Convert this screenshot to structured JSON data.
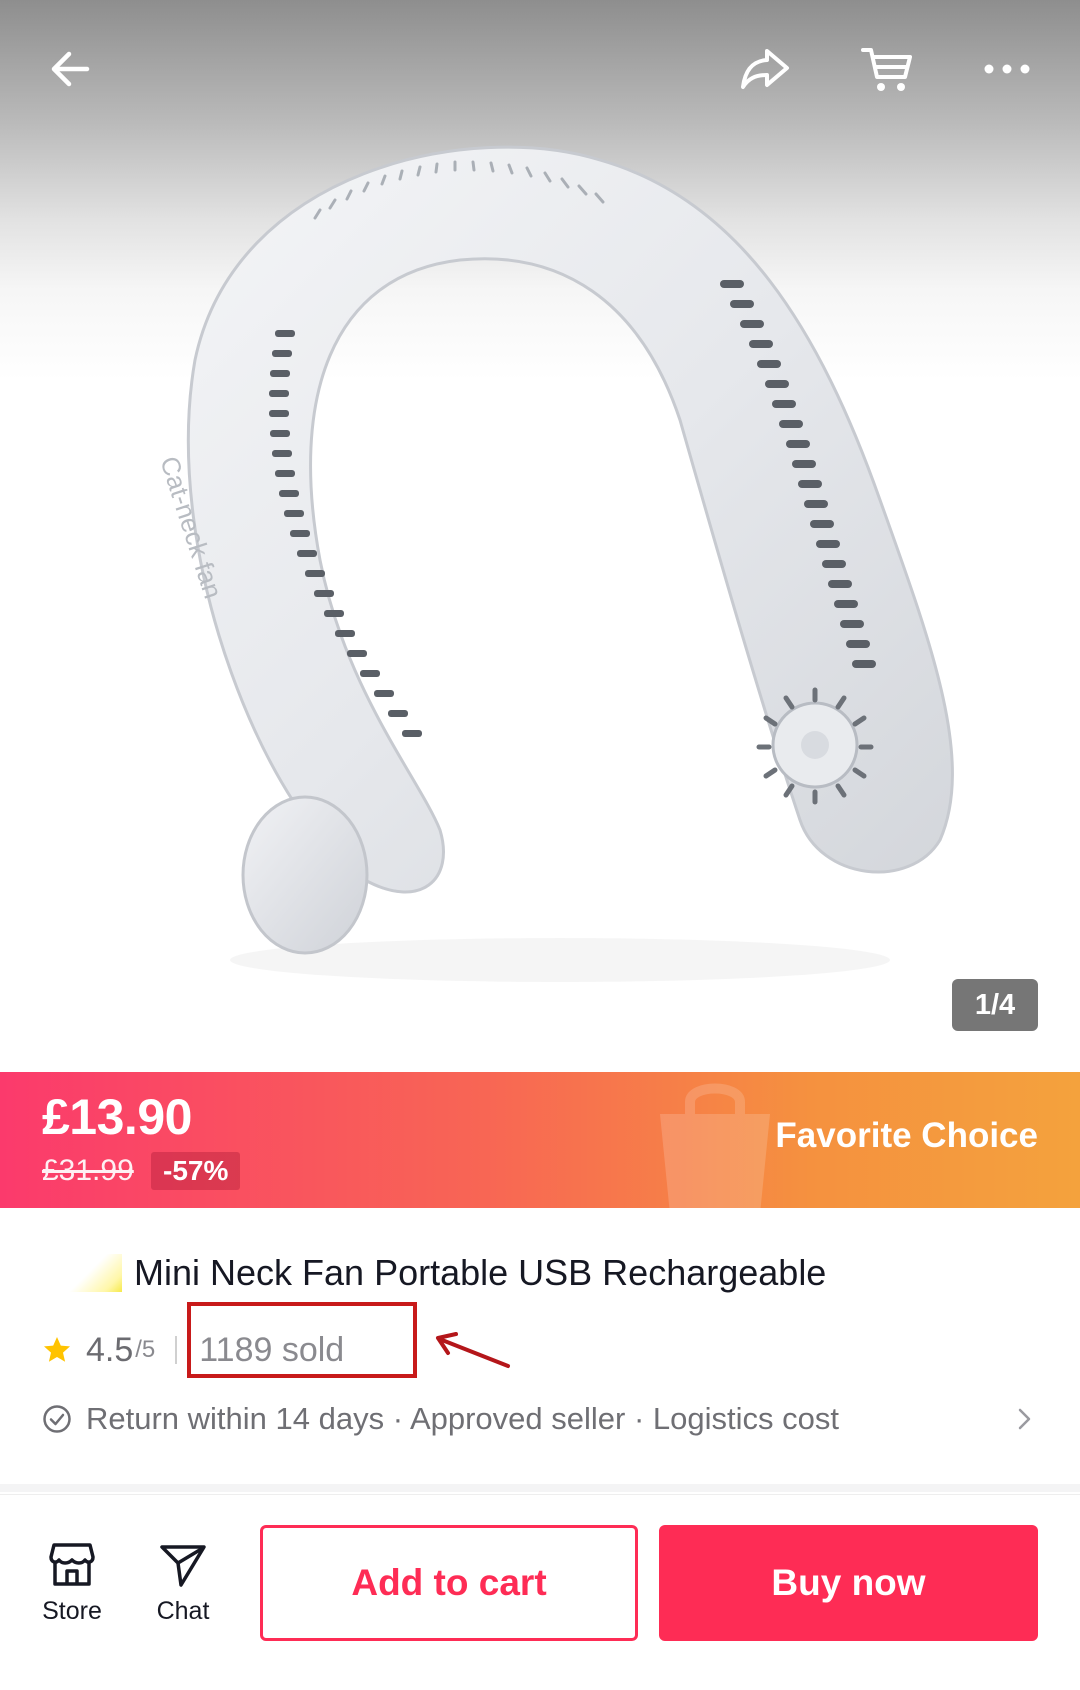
{
  "header": {
    "icons": [
      "back-icon",
      "share-icon",
      "cart-icon",
      "more-icon"
    ]
  },
  "gallery": {
    "counter": "1/4",
    "product_print": "Cat-neck fan"
  },
  "price": {
    "current": "£13.90",
    "original": "£31.99",
    "discount": "-57%",
    "badge": "Favorite Choice"
  },
  "product": {
    "title": "Mini Neck Fan Portable USB Rechargeable",
    "rating": "4.5",
    "rating_max": "/5",
    "sold": "1189 sold",
    "policies": "Return within 14 days · Approved seller · Logistics cost"
  },
  "bottom_bar": {
    "store_label": "Store",
    "chat_label": "Chat",
    "add_to_cart": "Add to cart",
    "buy_now": "Buy now"
  },
  "colors": {
    "brand": "#fe2c55",
    "star": "#ffc300",
    "annotation": "#c81a1a",
    "banner_start": "#fb3a6c",
    "banner_end": "#f4a23d"
  }
}
